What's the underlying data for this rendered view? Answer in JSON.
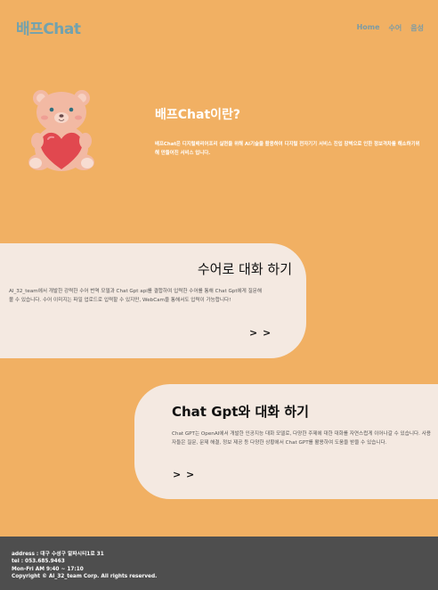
{
  "header": {
    "logo": "배프Chat",
    "nav": [
      "Home",
      "수어",
      "음성"
    ]
  },
  "hero": {
    "title": "배프Chat이란?",
    "description": "배프Chat은 디지털배리어프리 실현을 위해 AI기술을 활용하여 디지털 전자기기 서비스 진입 장벽으로 인한 정보격차를 해소하기위해 만들어진 서비스 입니다.",
    "image": "bear-holding-heart"
  },
  "cards": [
    {
      "title": "수어로 대화 하기",
      "text": "AI_32_team에서 개발한 강력한 수어 번역 모델과 Chat Gpt api를 결합하여 입력한 수어를 통해 Chat Gpt에게 질문해 볼 수 있습니다. 수어 이미지는 파일 업로드로 입력할 수 있지만, WebCam을 통해서도 입력이 가능합니다!",
      "arrow": "> >"
    },
    {
      "title": "Chat Gpt와 대화 하기",
      "text": "Chat GPT는 OpenAI에서 개발한 인공지능 대화 모델로, 다양한 주제에 대한 대화를 자연스럽게 이어나갈 수 있습니다. 사용자들은 질문, 문제 해결, 정보 제공 등 다양한 상황에서 Chat GPT를 활용하여 도움을 받을 수 있습니다.",
      "arrow": "> >"
    }
  ],
  "footer": {
    "address": "address : 대구 수성구 알파시티1로 31",
    "tel": "tel : 053.685.9463",
    "hours": "Mon-Fri AM 9:40 ~ 17:10",
    "copyright": "Copyright © Ai_32_team Corp. All rights reserved."
  },
  "colors": {
    "background": "#f1b063",
    "logo": "#72a2ae",
    "card": "#f4e9e1",
    "footer": "#4e4e4e"
  }
}
